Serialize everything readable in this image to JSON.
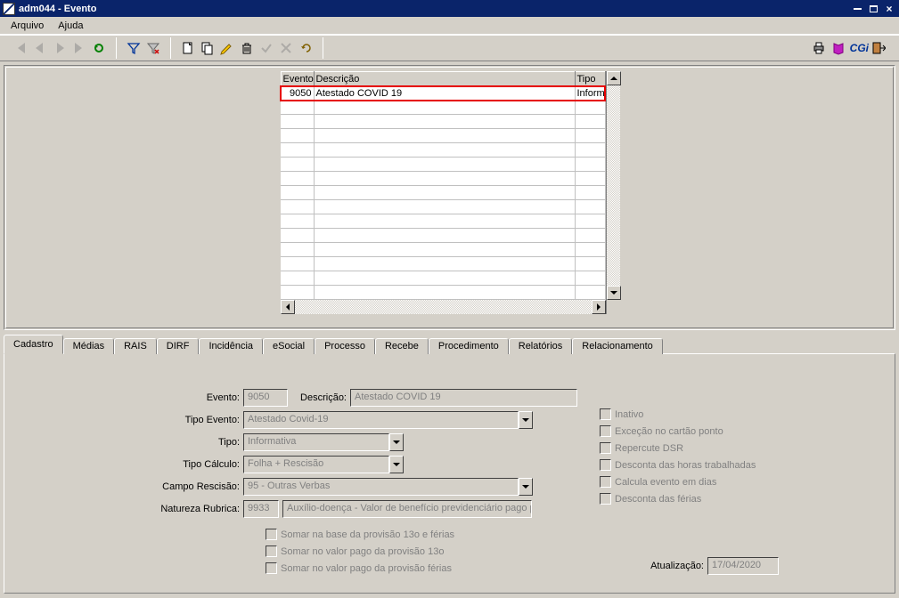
{
  "window": {
    "title": "adm044 - Evento"
  },
  "menu": {
    "arquivo": "Arquivo",
    "ajuda": "Ajuda"
  },
  "grid": {
    "headers": {
      "evento": "Evento",
      "descricao": "Descrição",
      "tipo": "Tipo"
    },
    "row": {
      "evento": "9050",
      "descricao": "Atestado COVID 19",
      "tipo": "Informa"
    }
  },
  "tabs": {
    "cadastro": "Cadastro",
    "medias": "Médias",
    "rais": "RAIS",
    "dirf": "DIRF",
    "incidencia": "Incidência",
    "esocial": "eSocial",
    "processo": "Processo",
    "recebe": "Recebe",
    "procedimento": "Procedimento",
    "relatorios": "Relatórios",
    "relacionamento": "Relacionamento"
  },
  "form": {
    "labels": {
      "evento": "Evento:",
      "descricao": "Descrição:",
      "tipo_evento": "Tipo Evento:",
      "tipo": "Tipo:",
      "tipo_calculo": "Tipo Cálculo:",
      "campo_rescisao": "Campo Rescisão:",
      "natureza_rubrica": "Natureza Rubrica:",
      "atualizacao": "Atualização:"
    },
    "values": {
      "evento": "9050",
      "descricao": "Atestado COVID 19",
      "tipo_evento": "Atestado Covid-19",
      "tipo": "Informativa",
      "tipo_calculo": "Folha + Rescisão",
      "campo_rescisao": "95 - Outras Verbas",
      "natureza_rubrica_code": "9933",
      "natureza_rubrica_desc": "Auxílio-doença - Valor de benefício previdenciário pago por",
      "atualizacao": "17/04/2020"
    },
    "checkboxes": {
      "inativo": "Inativo",
      "excecao": "Exceção no cartão ponto",
      "repercute_dsr": "Repercute DSR",
      "desconta_horas": "Desconta das horas trabalhadas",
      "calcula_dias": "Calcula evento em dias",
      "desconta_ferias": "Desconta das férias",
      "somar_base_13o": "Somar na base da provisão 13o e férias",
      "somar_valor_13o": "Somar no valor pago da provisão 13o",
      "somar_valor_ferias": "Somar no valor pago da provisão férias"
    }
  },
  "cgi": "CGi"
}
